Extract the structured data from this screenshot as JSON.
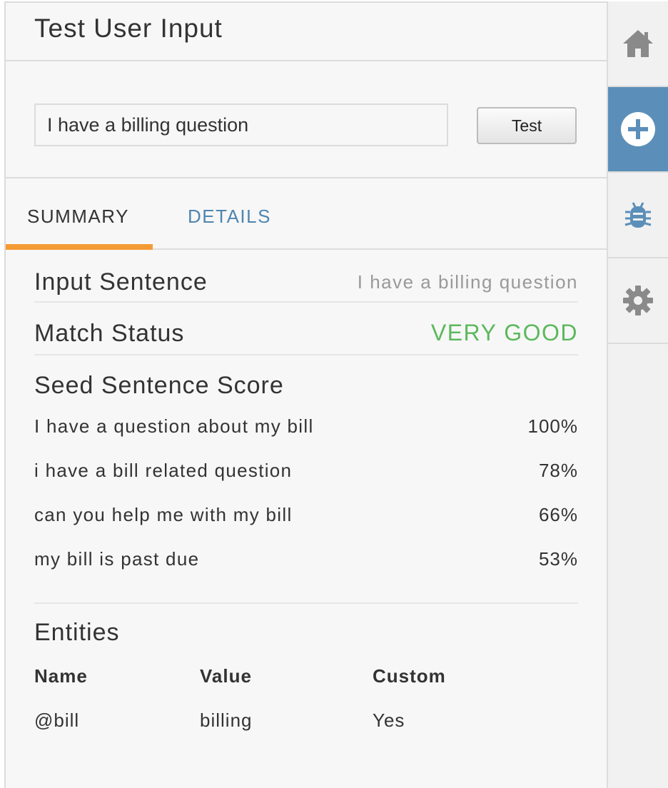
{
  "panel": {
    "title": "Test User Input"
  },
  "test_input": {
    "value": "I have a billing question",
    "button_label": "Test"
  },
  "tabs": [
    {
      "label": "SUMMARY",
      "active": true
    },
    {
      "label": "DETAILS",
      "active": false
    }
  ],
  "summary": {
    "input_sentence": {
      "label": "Input Sentence",
      "value": "I have a billing question"
    },
    "match_status": {
      "label": "Match Status",
      "value": "VERY GOOD"
    },
    "seed_title": "Seed Sentence Score",
    "seed_scores": [
      {
        "sentence": "I have a question about my bill",
        "score": "100%"
      },
      {
        "sentence": "i have a bill related question",
        "score": "78%"
      },
      {
        "sentence": "can you help me with my bill",
        "score": "66%"
      },
      {
        "sentence": "my bill is past due",
        "score": "53%"
      }
    ],
    "entities_title": "Entities",
    "entities_headers": [
      "Name",
      "Value",
      "Custom"
    ],
    "entities_rows": [
      [
        "@bill",
        "billing",
        "Yes"
      ]
    ]
  },
  "sidebar": {
    "items": [
      {
        "icon": "home-icon",
        "active": false
      },
      {
        "icon": "add-icon",
        "active": true
      },
      {
        "icon": "bug-icon",
        "active": false
      },
      {
        "icon": "gear-icon",
        "active": false
      }
    ]
  },
  "colors": {
    "accent_orange": "#f59b34",
    "accent_blue": "#5b8fb9",
    "link_blue": "#4f86b0",
    "success_green": "#5cb85c",
    "muted_gray": "#999999"
  }
}
